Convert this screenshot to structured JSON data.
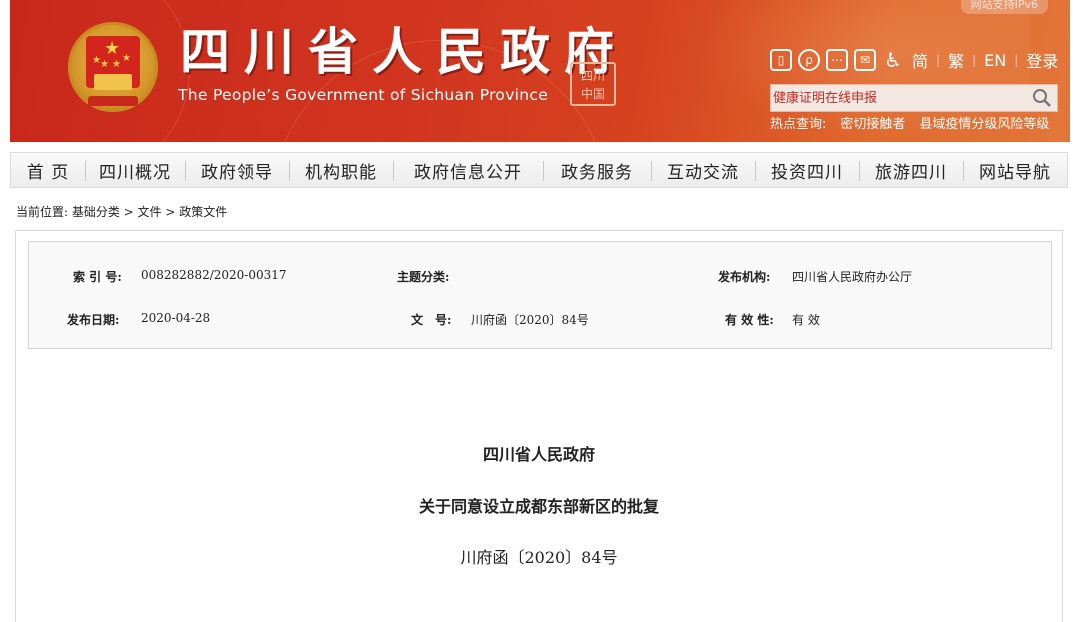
{
  "header": {
    "title": "四川省人民政府",
    "subtitle": "The People’s Government of Sichuan Province",
    "seal_text": "四川中国",
    "top_badge": "网站支持IPv6",
    "lang": {
      "simplified": "简",
      "traditional": "繁",
      "english": "EN",
      "login": "登录"
    },
    "search_placeholder": "健康证明在线申报",
    "hot_label": "热点查询:",
    "hot_links": [
      "密切接触者",
      "县域疫情分级风险等级"
    ],
    "colors": {
      "banner": "#c8281c",
      "accent": "#e2763a"
    },
    "tool_icons": [
      "mobile-icon",
      "weibo-icon",
      "wechat-icon",
      "mail-icon",
      "accessibility-icon"
    ]
  },
  "nav": {
    "items": [
      "首 页",
      "四川概况",
      "政府领导",
      "机构职能",
      "政府信息公开",
      "政务服务",
      "互动交流",
      "投资四川",
      "旅游四川",
      "网站导航"
    ]
  },
  "breadcrumb": "当前位置: 基础分类 > 文件 > 政策文件",
  "meta": {
    "index_label": "索 引 号:",
    "index_value": "008282882/2020-00317",
    "topic_label": "主题分类:",
    "topic_value": "",
    "publisher_label": "发布机构:",
    "publisher_value": "四川省人民政府办公厅",
    "date_label": "发布日期:",
    "date_value": "2020-04-28",
    "docno_label": "文　号:",
    "docno_value": "川府函〔2020〕84号",
    "validity_label": "有 效 性:",
    "validity_value": "有 效"
  },
  "document": {
    "org": "四川省人民政府",
    "title": "关于同意设立成都东部新区的批复",
    "number": "川府函〔2020〕84号"
  }
}
